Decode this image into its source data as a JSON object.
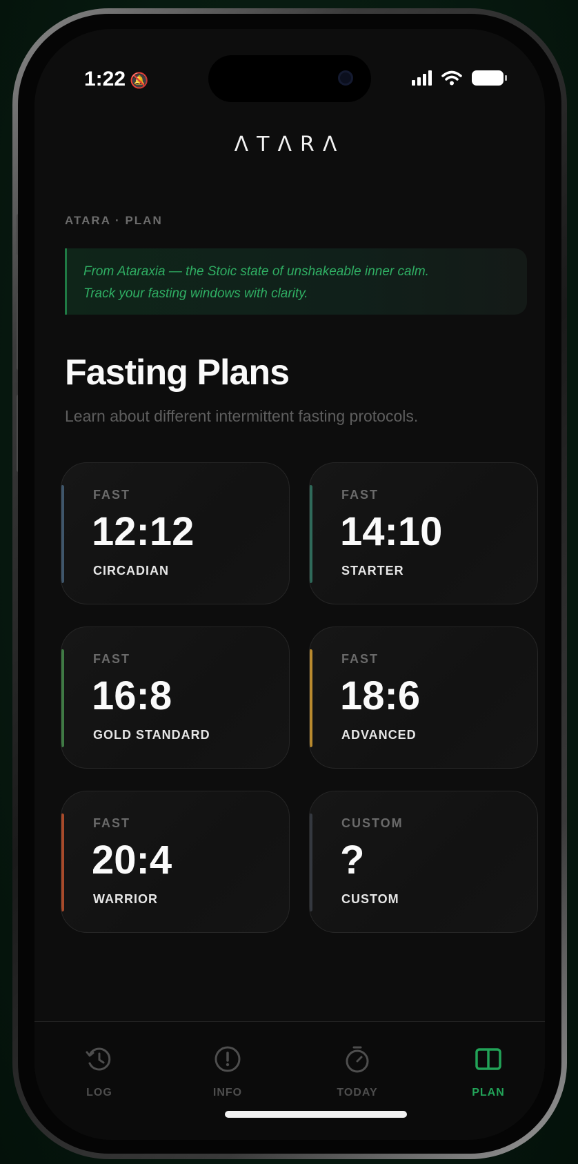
{
  "status_bar": {
    "time": "1:22"
  },
  "app": {
    "logo": "ΛTΛRΛ"
  },
  "eyebrow": "ATARA · PLAN",
  "quote": {
    "line1": "From Ataraxia — the Stoic state of unshakeable inner calm.",
    "line2": "Track your fasting windows with clarity."
  },
  "page": {
    "title": "Fasting Plans",
    "subtitle": "Learn about different intermittent fasting protocols."
  },
  "plans": [
    {
      "kicker": "FAST",
      "ratio": "12:12",
      "name": "CIRCADIAN",
      "accent": "#3f566b"
    },
    {
      "kicker": "FAST",
      "ratio": "14:10",
      "name": "STARTER",
      "accent": "#2f6a5a"
    },
    {
      "kicker": "FAST",
      "ratio": "16:8",
      "name": "GOLD STANDARD",
      "accent": "#3f7a44"
    },
    {
      "kicker": "FAST",
      "ratio": "18:6",
      "name": "ADVANCED",
      "accent": "#b98a2e"
    },
    {
      "kicker": "FAST",
      "ratio": "20:4",
      "name": "WARRIOR",
      "accent": "#a84a2a"
    },
    {
      "kicker": "CUSTOM",
      "ratio": "?",
      "name": "CUSTOM",
      "accent": "#34383f"
    }
  ],
  "tabs": [
    {
      "label": "LOG",
      "icon": "clock-history-icon",
      "active": false
    },
    {
      "label": "INFO",
      "icon": "info-icon",
      "active": false
    },
    {
      "label": "TODAY",
      "icon": "stopwatch-icon",
      "active": false
    },
    {
      "label": "PLAN",
      "icon": "book-open-icon",
      "active": true
    }
  ],
  "colors": {
    "accent_green": "#22a358",
    "background": "#0d0d0d"
  }
}
